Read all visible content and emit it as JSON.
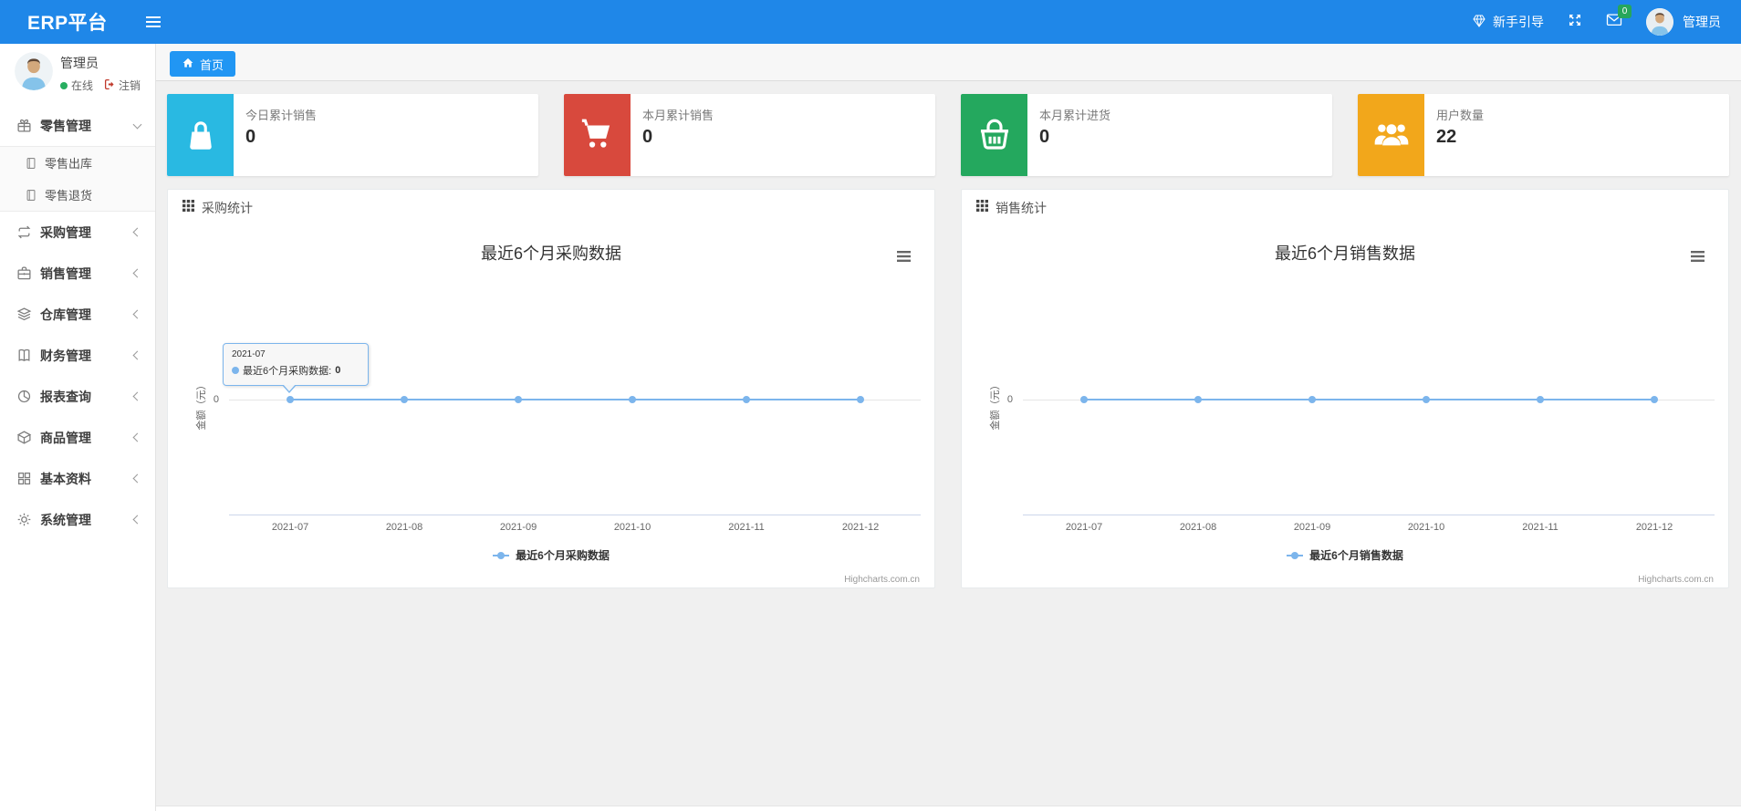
{
  "colors": {
    "navbar": "#1f87e8",
    "tab_active": "#2196f3",
    "badge": "#26a65b",
    "chart_line": "#7cb5ec"
  },
  "navbar": {
    "brand": "ERP平台",
    "guide_label": "新手引导",
    "mail_badge": "0",
    "user_label": "管理员"
  },
  "sidebar": {
    "user": {
      "name": "管理员",
      "status": "在线",
      "logout": "注销"
    },
    "items": [
      {
        "label": "零售管理",
        "icon": "gift-icon",
        "state": "expanded"
      },
      {
        "label": "零售出库",
        "icon": "journal-icon"
      },
      {
        "label": "零售退货",
        "icon": "journal-icon"
      },
      {
        "label": "采购管理",
        "icon": "repeat-icon",
        "state": "collapsed"
      },
      {
        "label": "销售管理",
        "icon": "briefcase-icon",
        "state": "collapsed"
      },
      {
        "label": "仓库管理",
        "icon": "layers-icon",
        "state": "collapsed"
      },
      {
        "label": "财务管理",
        "icon": "book-icon",
        "state": "collapsed"
      },
      {
        "label": "报表查询",
        "icon": "pie-chart-icon",
        "state": "collapsed"
      },
      {
        "label": "商品管理",
        "icon": "box-icon",
        "state": "collapsed"
      },
      {
        "label": "基本资料",
        "icon": "grid-icon",
        "state": "collapsed"
      },
      {
        "label": "系统管理",
        "icon": "gear-icon",
        "state": "collapsed"
      }
    ]
  },
  "breadcrumb": {
    "home_tab": "首页"
  },
  "stat_cards": [
    {
      "label": "今日累计销售",
      "value": "0",
      "color": "#29b9e2",
      "icon": "shopping-bag-icon"
    },
    {
      "label": "本月累计销售",
      "value": "0",
      "color": "#d8493d",
      "icon": "cart-icon"
    },
    {
      "label": "本月累计进货",
      "value": "0",
      "color": "#24a85e",
      "icon": "basket-icon"
    },
    {
      "label": "用户数量",
      "value": "22",
      "color": "#f2a71b",
      "icon": "users-icon"
    }
  ],
  "chart_data": [
    {
      "type": "line",
      "panel_title": "采购统计",
      "title": "最近6个月采购数据",
      "x": [
        "2021-07",
        "2021-08",
        "2021-09",
        "2021-10",
        "2021-11",
        "2021-12"
      ],
      "series": [
        {
          "name": "最近6个月采购数据",
          "values": [
            0,
            0,
            0,
            0,
            0,
            0
          ],
          "color": "#7cb5ec"
        }
      ],
      "ylabel": "金额（元）",
      "ytick_label": "0",
      "ylim": [
        0,
        1
      ],
      "grid": "zero-line-only",
      "legend_position": "bottom-center",
      "credit": "Highcharts.com.cn",
      "tooltip": {
        "header": "2021-07",
        "label": "最近6个月采购数据:",
        "value": "0"
      }
    },
    {
      "type": "line",
      "panel_title": "销售统计",
      "title": "最近6个月销售数据",
      "x": [
        "2021-07",
        "2021-08",
        "2021-09",
        "2021-10",
        "2021-11",
        "2021-12"
      ],
      "series": [
        {
          "name": "最近6个月销售数据",
          "values": [
            0,
            0,
            0,
            0,
            0,
            0
          ],
          "color": "#7cb5ec"
        }
      ],
      "ylabel": "金额（元）",
      "ytick_label": "0",
      "ylim": [
        0,
        1
      ],
      "grid": "zero-line-only",
      "legend_position": "bottom-center",
      "credit": "Highcharts.com.cn"
    }
  ]
}
